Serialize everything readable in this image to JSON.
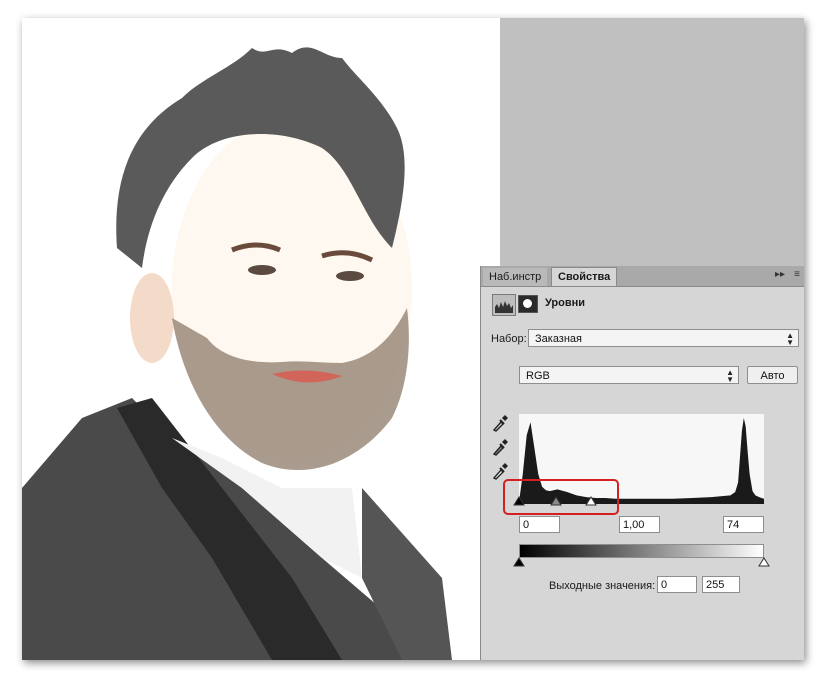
{
  "panel": {
    "tabs": [
      {
        "label": "Наб.инстр",
        "active": false
      },
      {
        "label": "Свойства",
        "active": true
      }
    ],
    "collapse_icon": "double-chevron-right-icon",
    "menu_icon": "panel-menu-icon",
    "header": {
      "adjustment_icon": "levels-histogram-icon",
      "mask_icon": "layer-mask-icon",
      "title": "Уровни"
    },
    "preset": {
      "label": "Набор:",
      "value": "Заказная"
    },
    "channel": {
      "value": "RGB"
    },
    "auto_label": "Авто",
    "eyedroppers": [
      "black-point-eyedropper-icon",
      "gray-point-eyedropper-icon",
      "white-point-eyedropper-icon"
    ],
    "input_levels": {
      "black": "0",
      "gamma": "1,00",
      "white": "74"
    },
    "output_levels": {
      "label": "Выходные значения:",
      "black": "0",
      "white": "255"
    }
  },
  "chart_data": {
    "type": "area",
    "title": "",
    "xlabel": "",
    "ylabel": "",
    "xlim": [
      0,
      255
    ],
    "x": [
      0,
      4,
      8,
      12,
      16,
      20,
      24,
      28,
      32,
      40,
      50,
      60,
      70,
      80,
      90,
      100,
      120,
      140,
      160,
      180,
      200,
      210,
      220,
      225,
      228,
      230,
      232,
      234,
      236,
      238,
      240,
      243,
      246,
      250,
      255
    ],
    "values": [
      0.02,
      0.35,
      0.8,
      0.95,
      0.65,
      0.35,
      0.2,
      0.16,
      0.15,
      0.17,
      0.14,
      0.1,
      0.08,
      0.07,
      0.07,
      0.06,
      0.06,
      0.06,
      0.06,
      0.07,
      0.08,
      0.09,
      0.1,
      0.14,
      0.25,
      0.55,
      0.85,
      1.0,
      0.9,
      0.6,
      0.35,
      0.15,
      0.1,
      0.08,
      0.06
    ]
  },
  "colors": {
    "panel_bg": "#d6d6d6",
    "workspace_bg": "#c0c0c0",
    "highlight": "#d42020"
  }
}
